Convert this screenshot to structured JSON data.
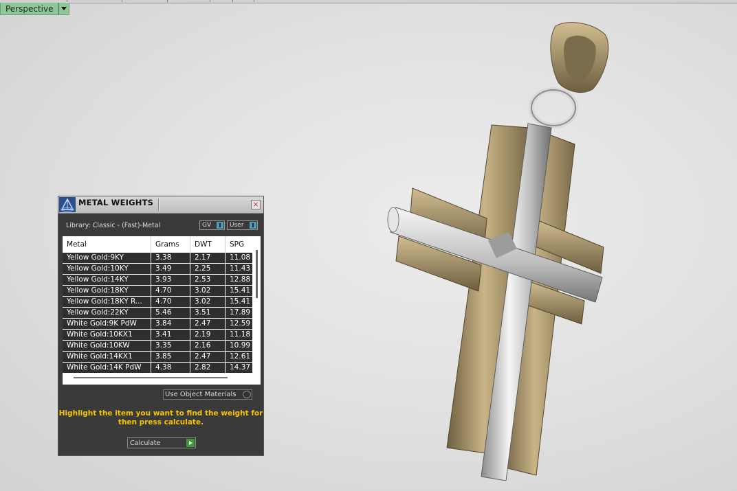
{
  "viewport": {
    "view_label": "Perspective"
  },
  "panel": {
    "title": "METAL WEIGHTS",
    "library": "Library: Classic - (Fast)-Metal",
    "toggle_gv": "GV",
    "toggle_user": "User",
    "columns": [
      "Metal",
      "Grams",
      "DWT",
      "SPG"
    ],
    "rows": [
      [
        "Yellow Gold:9KY",
        "3.38",
        "2.17",
        "11.08"
      ],
      [
        "Yellow Gold:10KY",
        "3.49",
        "2.25",
        "11.43"
      ],
      [
        "Yellow Gold:14KY",
        "3.93",
        "2.53",
        "12.88"
      ],
      [
        "Yellow Gold:18KY",
        "4.70",
        "3.02",
        "15.41"
      ],
      [
        "Yellow Gold:18KY R...",
        "4.70",
        "3.02",
        "15.41"
      ],
      [
        "Yellow Gold:22KY",
        "5.46",
        "3.51",
        "17.89"
      ],
      [
        "White Gold:9K PdW",
        "3.84",
        "2.47",
        "12.59"
      ],
      [
        "White Gold:10KX1",
        "3.41",
        "2.19",
        "11.18"
      ],
      [
        "White Gold:10KW",
        "3.35",
        "2.16",
        "10.99"
      ],
      [
        "White Gold:14KX1",
        "3.85",
        "2.47",
        "12.61"
      ],
      [
        "White Gold:14K PdW",
        "4.38",
        "2.82",
        "14.37"
      ]
    ],
    "use_object_materials": "Use Object Materials",
    "hint": "Highlight the item you want to find the weight for then press calculate.",
    "calculate_label": "Calculate"
  },
  "colors": {
    "view_tab": "#8fc79a",
    "hint": "#f5c400",
    "gold": "#b8a274",
    "silver": "#d8d8d8"
  }
}
